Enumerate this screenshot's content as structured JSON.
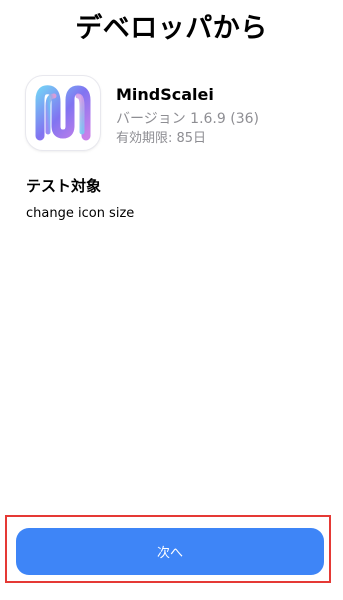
{
  "header": {
    "title": "デベロッパから"
  },
  "app": {
    "name": "MindScalei",
    "version": "バージョン 1.6.9 (36)",
    "expiry": "有効期限: 85日",
    "icon": "mindscalei-app-icon"
  },
  "test_section": {
    "heading": "テスト対象",
    "notes": "change icon size"
  },
  "actions": {
    "next_label": "次へ"
  },
  "colors": {
    "accent": "#3e85f7",
    "secondary_text": "#8e8e93",
    "highlight": "#e53935"
  }
}
